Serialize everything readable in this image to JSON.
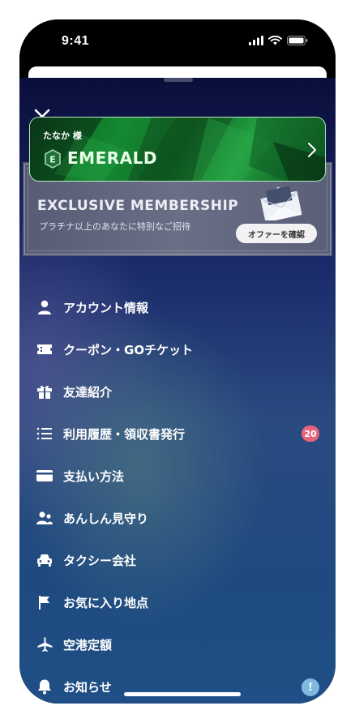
{
  "status_bar": {
    "time": "9:41"
  },
  "card": {
    "greeting": "たなか 様",
    "rank": "EMERALD",
    "rank_initial": "E"
  },
  "promo": {
    "title": "EXCLUSIVE MEMBERSHIP",
    "subtitle": "プラチナ以上のあなたに特別なご招待",
    "button_label": "オファーを確認"
  },
  "menu": {
    "items": [
      {
        "label": "アカウント情報",
        "icon": "person-icon"
      },
      {
        "label": "クーポン・GOチケット",
        "icon": "ticket-icon"
      },
      {
        "label": "友達紹介",
        "icon": "gift-icon"
      },
      {
        "label": "利用履歴・領収書発行",
        "icon": "list-icon",
        "badge": "20"
      },
      {
        "label": "支払い方法",
        "icon": "card-icon"
      },
      {
        "label": "あんしん見守り",
        "icon": "people-icon"
      },
      {
        "label": "タクシー会社",
        "icon": "taxi-icon"
      },
      {
        "label": "お気に入り地点",
        "icon": "flag-icon"
      },
      {
        "label": "空港定額",
        "icon": "airplane-icon"
      },
      {
        "label": "お知らせ",
        "icon": "bell-icon",
        "badge": "!"
      }
    ]
  },
  "colors": {
    "count_badge": "#e6657a",
    "info_badge": "#7fb9de",
    "emerald": "#13802e"
  }
}
